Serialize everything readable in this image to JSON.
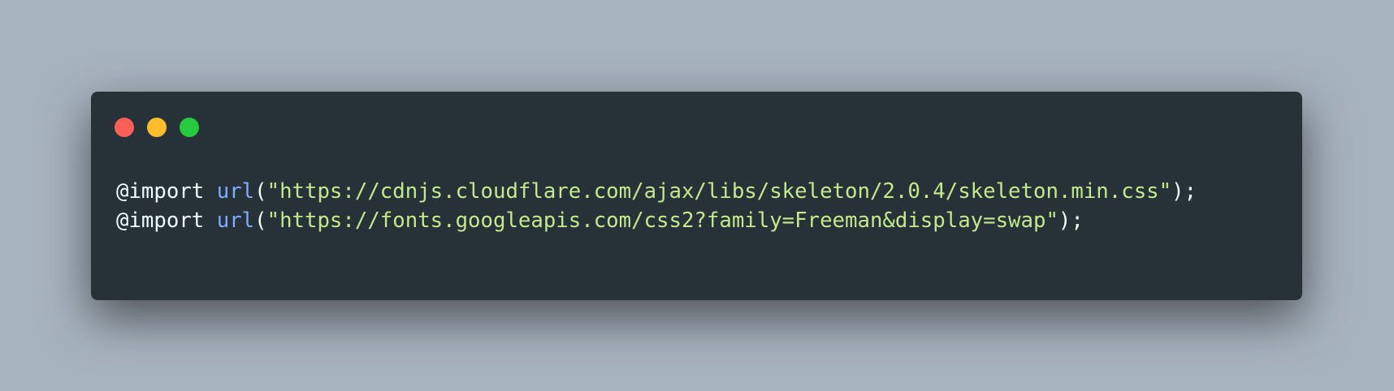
{
  "window": {
    "controls": [
      {
        "name": "close",
        "color": "#ff5f56"
      },
      {
        "name": "minimize",
        "color": "#ffbd2e"
      },
      {
        "name": "maximize",
        "color": "#27c93f"
      }
    ]
  },
  "colors": {
    "background": "#a7b3bf",
    "window_bg": "#263238",
    "text": "#eeffff",
    "function": "#82aaff",
    "string": "#c3e88d",
    "punctuation": "#eeffff"
  },
  "code": {
    "lines": [
      {
        "keyword": "@import",
        "func": "url",
        "open": "(",
        "string": "\"https://cdnjs.cloudflare.com/ajax/libs/skeleton/2.0.4/skeleton.min.css\"",
        "close": ");"
      },
      {
        "keyword": "@import",
        "func": "url",
        "open": "(",
        "string": "\"https://fonts.googleapis.com/css2?family=Freeman&display=swap\"",
        "close": ");"
      }
    ]
  }
}
